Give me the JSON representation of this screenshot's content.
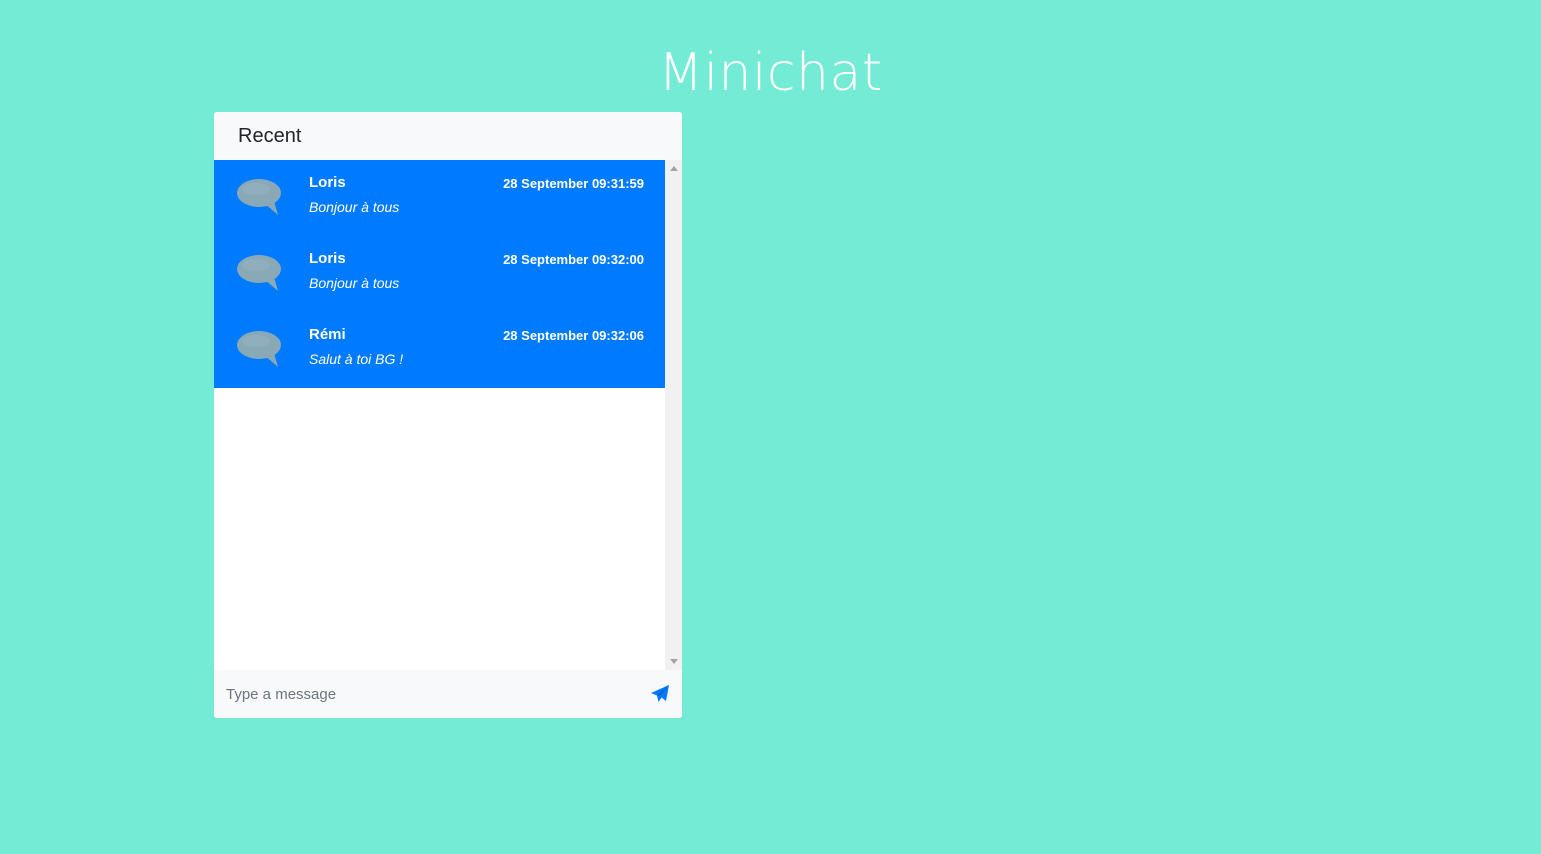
{
  "app": {
    "title": "Minichat"
  },
  "panel": {
    "header": "Recent",
    "messages": [
      {
        "author": "Loris",
        "time": "28 September 09:31:59",
        "text": "Bonjour à tous",
        "icon": "speech-bubble-icon"
      },
      {
        "author": "Loris",
        "time": "28 September 09:32:00",
        "text": "Bonjour à tous",
        "icon": "speech-bubble-icon"
      },
      {
        "author": "Rémi",
        "time": "28 September 09:32:06",
        "text": "Salut à toi BG !",
        "icon": "speech-bubble-icon"
      }
    ],
    "composer": {
      "placeholder": "Type a message",
      "value": "",
      "send_icon": "paper-plane-icon"
    }
  },
  "colors": {
    "background": "#74ebd5",
    "message_bg": "#007bff",
    "send_icon": "#007bff"
  }
}
